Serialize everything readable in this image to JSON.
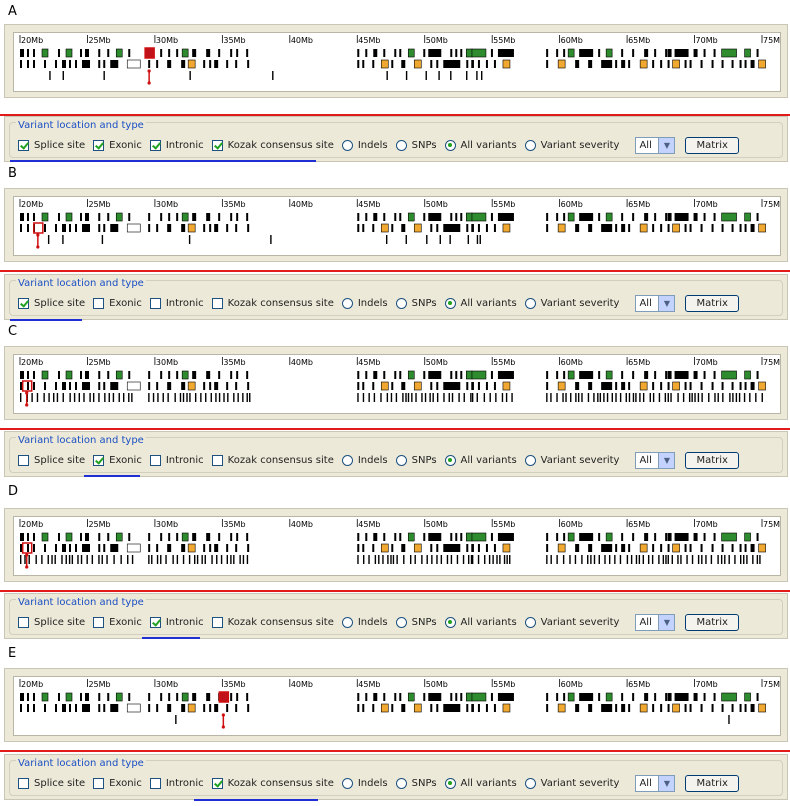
{
  "ticks": [
    "20Mb",
    "25Mb",
    "30Mb",
    "35Mb",
    "40Mb",
    "45Mb",
    "50Mb",
    "55Mb",
    "60Mb",
    "65Mb",
    "70Mb",
    "75Mb"
  ],
  "controls": {
    "legend": "Variant location and type",
    "splice": "Splice site",
    "exonic": "Exonic",
    "intronic": "Intronic",
    "kozak": "Kozak consensus site",
    "indels": "Indels",
    "snps": "SNPs",
    "all_variants": "All variants",
    "severity": "Variant severity",
    "select_value": "All",
    "matrix": "Matrix"
  },
  "panels": [
    {
      "letter": "A",
      "checked": [
        "splice",
        "exonic",
        "intronic",
        "kozak"
      ],
      "highlight": 0.17,
      "variant_density": "sparse"
    },
    {
      "letter": "B",
      "checked": [
        "splice"
      ],
      "highlight": 0.02,
      "variant_density": "sparse"
    },
    {
      "letter": "C",
      "checked": [
        "exonic"
      ],
      "highlight": 0.005,
      "variant_density": "dense"
    },
    {
      "letter": "D",
      "checked": [
        "intronic"
      ],
      "highlight": 0.005,
      "variant_density": "dense"
    },
    {
      "letter": "E",
      "checked": [
        "kozak"
      ],
      "highlight": 0.27,
      "variant_density": "very_sparse"
    }
  ]
}
